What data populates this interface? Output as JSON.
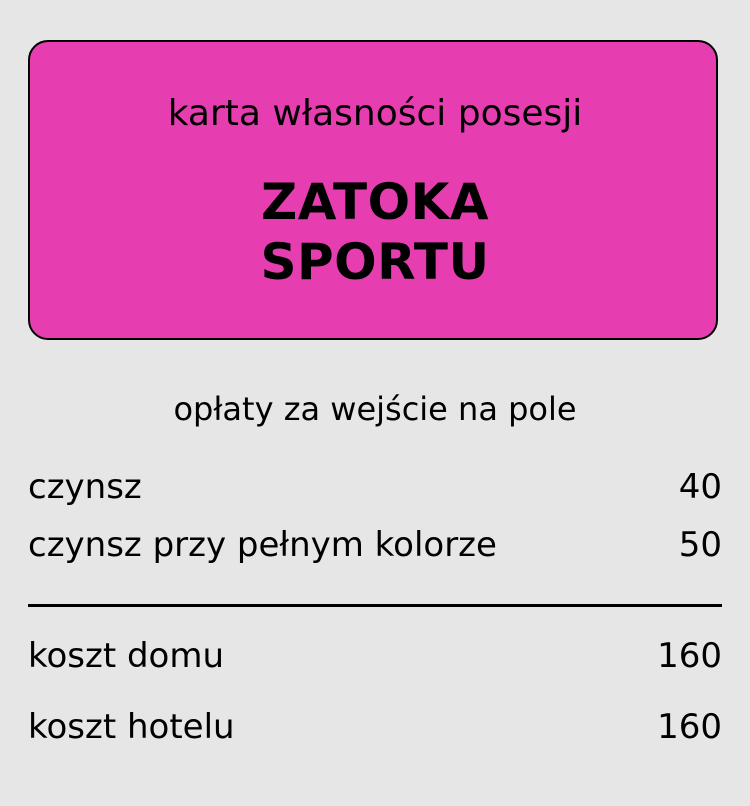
{
  "card": {
    "subtitle": "karta własności posesji",
    "title_line1": "ZATOKA",
    "title_line2": "SPORTU",
    "color": "#e63eb0"
  },
  "fees": {
    "heading": "opłaty za wejście na pole",
    "rent_label": "czynsz",
    "rent_value": "40",
    "rent_full_label": "czynsz przy pełnym kolorze",
    "rent_full_value": "50"
  },
  "costs": {
    "house_label": "koszt domu",
    "house_value": "160",
    "hotel_label": "koszt hotelu",
    "hotel_value": "160"
  }
}
